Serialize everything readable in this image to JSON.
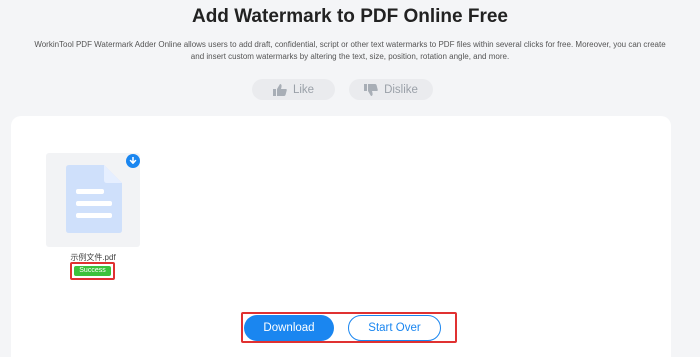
{
  "header": {
    "title": "Add Watermark to PDF Online Free",
    "description_line1": "WorkinTool PDF Watermark Adder Online allows users to add draft, confidential, script or other text watermarks to PDF files within several clicks for free. Moreover, you can create",
    "description_line2": "and insert custom watermarks by altering the text, size, position, rotation angle, and more."
  },
  "feedback": {
    "like_label": "Like",
    "dislike_label": "Dislike"
  },
  "file": {
    "name": "示例文件.pdf",
    "status": "Success",
    "status_color": "#3cc23c"
  },
  "actions": {
    "download_label": "Download",
    "start_over_label": "Start Over"
  },
  "colors": {
    "accent": "#1a86f0",
    "highlight_border": "#e03131"
  }
}
